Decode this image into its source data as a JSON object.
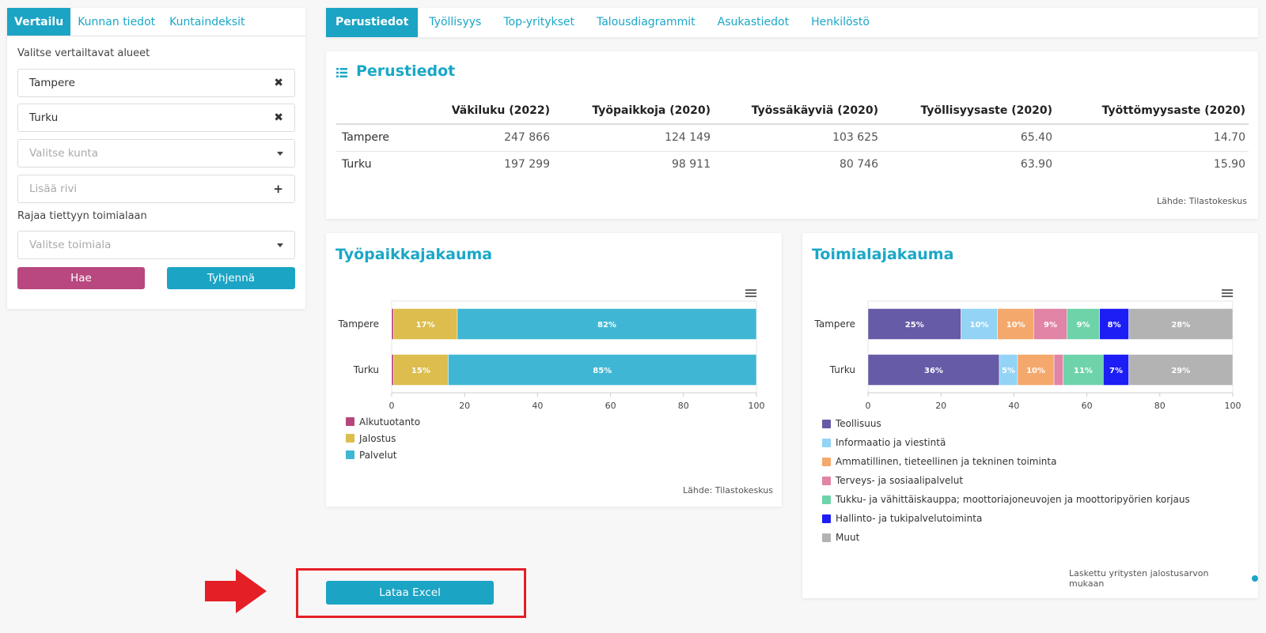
{
  "left_panel": {
    "tabs": [
      "Vertailu",
      "Kunnan tiedot",
      "Kuntaindeksit"
    ],
    "compare_label": "Valitse vertailtavat alueet",
    "selected_regions": [
      "Tampere",
      "Turku"
    ],
    "municipality_placeholder": "Valitse kunta",
    "add_row_placeholder": "Lisää rivi",
    "industry_label": "Rajaa tiettyyn toimialaan",
    "industry_placeholder": "Valitse toimiala",
    "search_button": "Hae",
    "clear_button": "Tyhjennä"
  },
  "top_nav": {
    "tabs": [
      "Perustiedot",
      "Työllisyys",
      "Top-yritykset",
      "Talousdiagrammit",
      "Asukastiedot",
      "Henkilöstö"
    ]
  },
  "perustiedot": {
    "title": "Perustiedot",
    "columns": [
      "",
      "Väkiluku (2022)",
      "Työpaikkoja (2020)",
      "Työssäkäyviä (2020)",
      "Työllisyysaste (2020)",
      "Työttömyysaste (2020)"
    ],
    "rows": [
      [
        "Tampere",
        "247 866",
        "124 149",
        "103 625",
        "65.40",
        "14.70"
      ],
      [
        "Turku",
        "197 299",
        "98 911",
        "80 746",
        "63.90",
        "15.90"
      ]
    ],
    "source": "Lähde: Tilastokeskus"
  },
  "chart_data": [
    {
      "type": "bar",
      "orientation": "horizontal",
      "stacked": true,
      "title": "Työpaikkajakauma",
      "categories": [
        "Tampere",
        "Turku"
      ],
      "series": [
        {
          "name": "Alkutuotanto",
          "color": "#b5467c",
          "values": [
            0.5,
            0.5
          ],
          "labels": [
            "",
            ""
          ]
        },
        {
          "name": "Jalostus",
          "color": "#dcbd4e",
          "values": [
            17.5,
            15
          ],
          "labels": [
            "17%",
            "15%"
          ]
        },
        {
          "name": "Palvelut",
          "color": "#3fb7d4",
          "values": [
            82,
            84.5
          ],
          "labels": [
            "82%",
            "85%"
          ]
        }
      ],
      "xlim": [
        0,
        100
      ],
      "xticks": [
        "0",
        "20",
        "40",
        "60",
        "80",
        "100"
      ],
      "legend_position": "bottom-left",
      "source": "Lähde: Tilastokeskus"
    },
    {
      "type": "bar",
      "orientation": "horizontal",
      "stacked": true,
      "title": "Toimialajakauma",
      "categories": [
        "Tampere",
        "Turku"
      ],
      "series": [
        {
          "name": "Teollisuus",
          "color": "#665ba6",
          "values": [
            25.5,
            36
          ],
          "labels": [
            "25%",
            "36%"
          ]
        },
        {
          "name": "Informaatio ja viestintä",
          "color": "#93d3f5",
          "values": [
            10,
            5
          ],
          "labels": [
            "10%",
            "5%"
          ]
        },
        {
          "name": "Ammatillinen, tieteellinen ja tekninen toiminta",
          "color": "#f4a86b",
          "values": [
            10,
            10
          ],
          "labels": [
            "10%",
            "10%"
          ]
        },
        {
          "name": "Terveys- ja sosiaalipalvelut",
          "color": "#e184a5",
          "values": [
            9,
            2.5
          ],
          "labels": [
            "9%",
            ""
          ]
        },
        {
          "name": "Tukku- ja vähittäiskauppa; moottoriajoneuvojen ja moottoripyörien korjaus",
          "color": "#6fd3aa",
          "values": [
            9,
            11
          ],
          "labels": [
            "9%",
            "11%"
          ]
        },
        {
          "name": "Hallinto- ja tukipalvelutoiminta",
          "color": "#1d1df5",
          "values": [
            8,
            7
          ],
          "labels": [
            "8%",
            "7%"
          ]
        },
        {
          "name": "Muut",
          "color": "#b3b3b3",
          "values": [
            28.5,
            28.5
          ],
          "labels": [
            "28%",
            "29%"
          ]
        }
      ],
      "xlim": [
        0,
        100
      ],
      "xticks": [
        "0",
        "20",
        "40",
        "60",
        "80",
        "100"
      ],
      "legend_position": "bottom-left",
      "note": "Laskettu yritysten jalostusarvon mukaan"
    }
  ],
  "excel_button": "Lataa Excel",
  "colors": {
    "accent": "#1ba4c4",
    "search_button": "#b8487f",
    "highlight": "#e41f26"
  }
}
